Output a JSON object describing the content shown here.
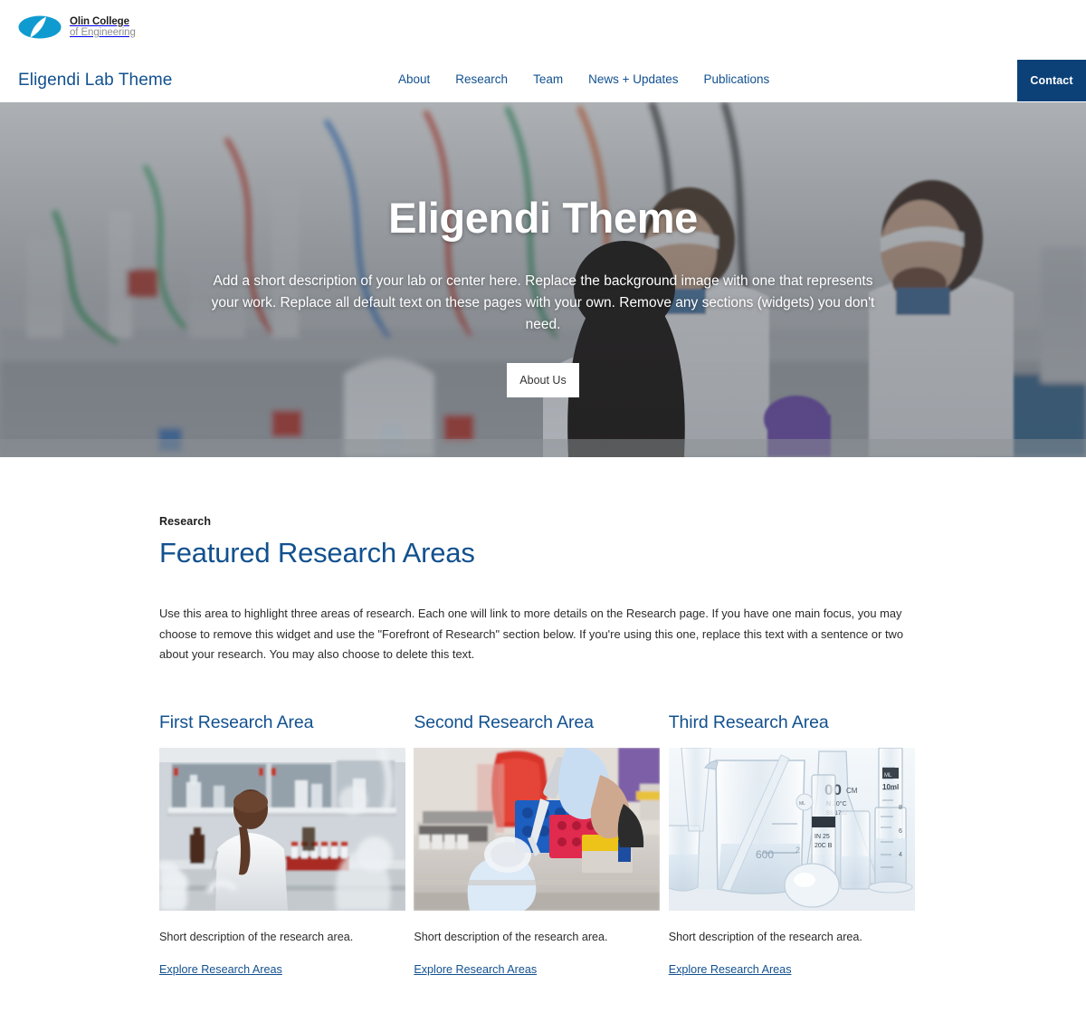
{
  "header": {
    "logo": {
      "mark_name": "olin-logo-mark",
      "line1": "Olin College",
      "line2": "of Engineering",
      "mark_color": "#0f9bd0"
    },
    "site_title": "Eligendi Lab Theme",
    "nav": [
      {
        "label": "About",
        "name": "nav-about"
      },
      {
        "label": "Research",
        "name": "nav-research"
      },
      {
        "label": "Team",
        "name": "nav-team"
      },
      {
        "label": "News + Updates",
        "name": "nav-news-updates"
      },
      {
        "label": "Publications",
        "name": "nav-publications"
      }
    ],
    "contact_label": "Contact",
    "contact_color": "#0c4178",
    "link_color": "#12518f"
  },
  "hero": {
    "title": "Eligendi Theme",
    "subtitle": "Add a short description of your lab or center here. Replace the background image with one that represents your work. Replace all default text on these pages with your own. Remove any sections (widgets) you don't need.",
    "button_label": "About Us",
    "image_alt": "researchers-in-laboratory"
  },
  "research": {
    "eyebrow": "Research",
    "title": "Featured Research Areas",
    "body": "Use this area to highlight three areas of research. Each one will link to more details on the Research page. If you have one main focus, you may choose to remove this widget and use the \"Forefront of Research\" section below. If you're using this one, replace this text with a sentence or two about your research. You may also choose to delete this text.",
    "cards": [
      {
        "title": "First Research Area",
        "description": "Short description of the research area.",
        "link_label": "Explore Research Areas",
        "image_alt": "researcher-at-lab-bench"
      },
      {
        "title": "Second Research Area",
        "description": "Short description of the research area.",
        "link_label": "Explore Research Areas",
        "image_alt": "gloved-hands-pipetting-samples"
      },
      {
        "title": "Third Research Area",
        "description": "Short description of the research area.",
        "link_label": "Explore Research Areas",
        "image_alt": "laboratory-glassware-beakers"
      }
    ]
  }
}
